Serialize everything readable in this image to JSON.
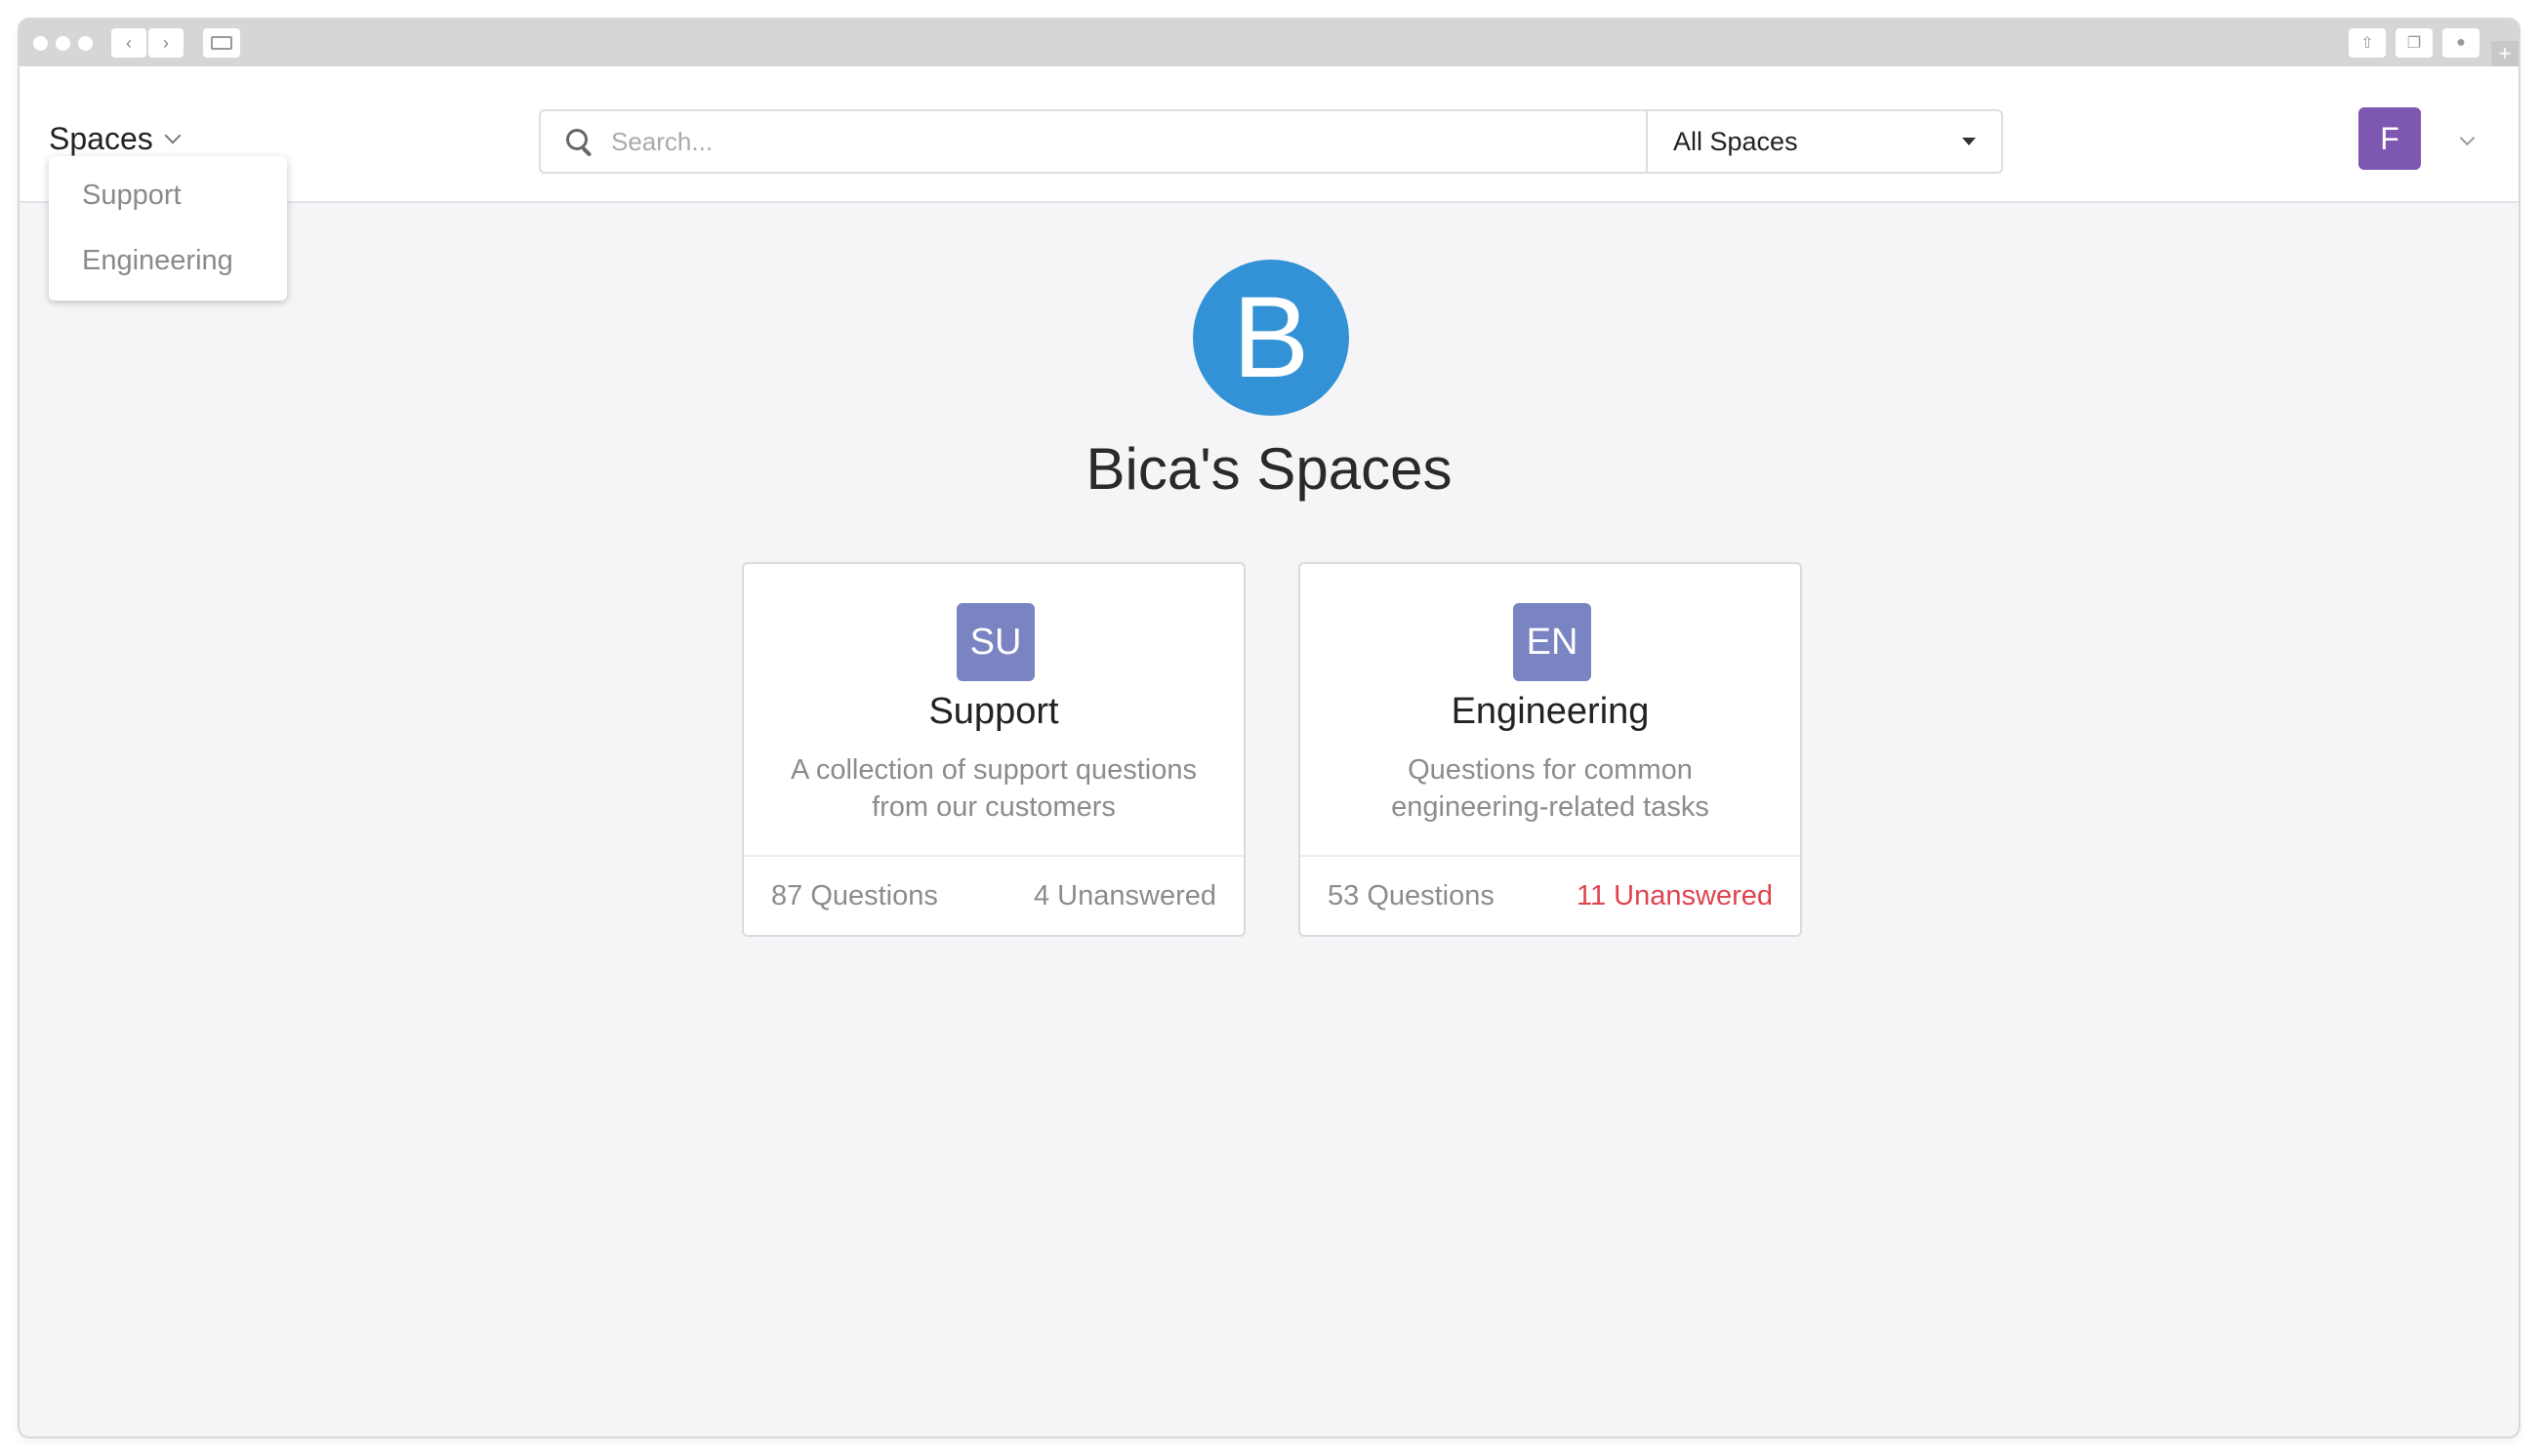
{
  "header": {
    "spaces_menu_label": "Spaces",
    "search_placeholder": "Search...",
    "scope_selected": "All Spaces",
    "user_initial": "F"
  },
  "spaces_dropdown": {
    "items": [
      {
        "label": "Support"
      },
      {
        "label": "Engineering"
      }
    ]
  },
  "organization": {
    "logo_letter": "B",
    "title": "Bica's Spaces",
    "logo_color": "#3392d6"
  },
  "spaces": [
    {
      "badge": "SU",
      "name": "Support",
      "description": "A collection of support questions from our customers",
      "questions": "87 Questions",
      "unanswered": "4 Unanswered"
    },
    {
      "badge": "EN",
      "name": "Engineering",
      "description": "Questions for common engineering-related tasks",
      "questions": "53 Questions",
      "unanswered": "11 Unanswered"
    }
  ],
  "colors": {
    "avatar": "#7e57b0",
    "space_badge": "#7a84c2",
    "alert": "#e0434f"
  }
}
